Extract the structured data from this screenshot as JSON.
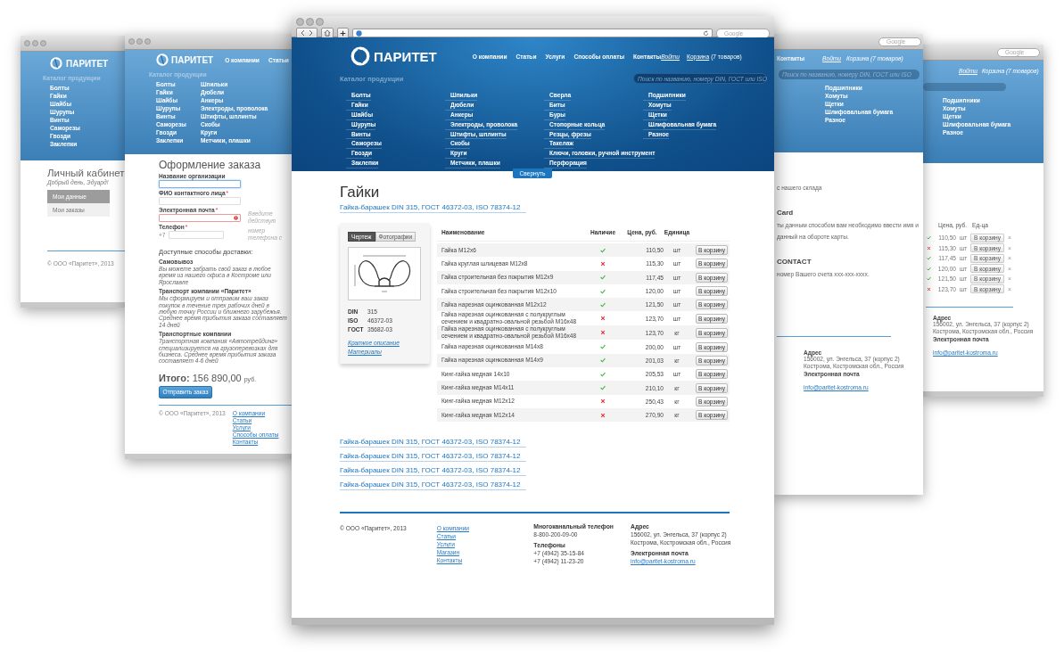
{
  "account_window": {
    "logo": "ПАРИТЕТ",
    "catalog_title": "Каталог продукции",
    "catalog_items": [
      "Болты",
      "Гайки",
      "Шайбы",
      "Шурупы",
      "Винты",
      "Саморезы",
      "Гвозди",
      "Заклепки"
    ],
    "title": "Личный кабинет",
    "greeting": "Добрый день, Эдуард!",
    "menu": [
      {
        "label": "Мои данные",
        "selected": true
      },
      {
        "label": "Мои заказы",
        "selected": false
      }
    ],
    "copyright": "© ООО «Паритет», 2013"
  },
  "order_window": {
    "logo": "ПАРИТЕТ",
    "nav": [
      "О компании",
      "Статьи"
    ],
    "catalog_title": "Каталог продукции",
    "catalog_columns": [
      [
        "Болты",
        "Гайки",
        "Шайбы",
        "Шурупы",
        "Винты",
        "Саморезы",
        "Гвозди",
        "Заклепки"
      ],
      [
        "Шпильки",
        "Дюбели",
        "Анкеры",
        "Электроды, проволока",
        "Штифты, шплинты",
        "Скобы",
        "Круги",
        "Метчики, плашки"
      ]
    ],
    "title": "Оформление заказа",
    "fields": [
      {
        "label": "Название организации",
        "focused": true,
        "error": false
      },
      {
        "label": "ФИО контактного лица",
        "required_mark": "*",
        "focused": false,
        "error": false
      },
      {
        "label": "Электронная почта",
        "required_mark": "*",
        "focused": false,
        "error": true,
        "hint": "Введите действую"
      },
      {
        "label": "Телефон",
        "required_mark": "*",
        "focused": false,
        "error": false,
        "prefix": "+7",
        "hint": "номер телефона с"
      }
    ],
    "delivery_title": "Доступные способы доставки:",
    "delivery": [
      {
        "name": "Самовывоз",
        "text": "Вы можете забрать свой заказ в любое время из нашего офиса в Костроме или Ярославле"
      },
      {
        "name": "Транспорт компании «Паритет»",
        "text": "Мы сформируем и отправим ваш заказ покупок в течение трех рабочих дней в любую точку России и ближнего зарубежья. Среднее время прибытия заказа составляет 14 дней"
      },
      {
        "name": "Транспортные компании",
        "text": "Транспортная компания «Автотрейдинг» специализируется на грузоперевозках для бизнеса. Среднее время прибытия заказа составляет 4-6 дней"
      }
    ],
    "total_label": "Итого:",
    "total": "156 890,00",
    "currency": "руб.",
    "submit": "Отправить заказ",
    "copyright": "© ООО «Паритет», 2013",
    "footer_links": [
      "О компании",
      "Статьи",
      "Услуги",
      "Способы оплаты",
      "Контакты"
    ]
  },
  "main_window": {
    "browser": {
      "search_placeholder": "Google"
    },
    "header": {
      "logo": "ПАРИТЕТ",
      "nav": [
        "О компании",
        "Статьи",
        "Услуги",
        "Способы оплаты",
        "Контакты"
      ],
      "login": "Войти",
      "cart": "Корзина",
      "cart_count": "(7 товаров)"
    },
    "catalog": {
      "title": "Каталог продукции",
      "search_placeholder": "Поиск по названию, номеру DIN, ГОСТ или ISO",
      "columns": [
        [
          "Болты",
          "Гайки",
          "Шайбы",
          "Шурупы",
          "Винты",
          "Саморезы",
          "Гвозди",
          "Заклепки"
        ],
        [
          "Шпильки",
          "Дюбели",
          "Анкеры",
          "Электроды, проволока",
          "Штифты, шплинты",
          "Скобы",
          "Круги",
          "Метчики, плашки"
        ],
        [
          "Сверла",
          "Биты",
          "Буры",
          "Стопорные кольца",
          "Резцы, фрезы",
          "Такелаж",
          "Ключи, головки, ручной инструмент",
          "Перфорация"
        ],
        [
          "Подшипники",
          "Хомуты",
          "Щетки",
          "Шлифовальная бумага",
          "Разное"
        ]
      ],
      "collapse": "Свернуть"
    },
    "page": {
      "title": "Гайки",
      "product_link": "Гайка-барашек DIN 315, ГОСТ 46372-03, ISO 78374-12",
      "card": {
        "tabs": [
          {
            "label": "Чертеж",
            "selected": true
          },
          {
            "label": "Фотографии",
            "selected": false
          }
        ],
        "specs": [
          {
            "label": "DIN",
            "value": "315"
          },
          {
            "label": "ISO",
            "value": "46372-03"
          },
          {
            "label": "ГОСТ",
            "value": "35682-03"
          }
        ],
        "links": [
          "Краткое описание",
          "Материалы"
        ]
      },
      "table": {
        "columns": [
          "Наименование",
          "Наличие",
          "Цена, руб.",
          "Единица"
        ],
        "rows": [
          {
            "name": "Гайка М12х6",
            "in_stock": true,
            "price": "110,50",
            "unit": "шт",
            "button": "В корзину"
          },
          {
            "name": "Гайка круглая шлицевая М12х8",
            "in_stock": false,
            "price": "115,30",
            "unit": "шт",
            "button": "В корзину"
          },
          {
            "name": "Гайка строительная без покрытия М12х9",
            "in_stock": true,
            "price": "117,45",
            "unit": "шт",
            "button": "В корзину"
          },
          {
            "name": "Гайка строительная без покрытия М12х10",
            "in_stock": true,
            "price": "120,00",
            "unit": "шт",
            "button": "В корзину"
          },
          {
            "name": "Гайка нарезная оцинкованная М12х12",
            "in_stock": true,
            "price": "121,50",
            "unit": "шт",
            "button": "В корзину"
          },
          {
            "name": "Гайка нарезная оцинкованная с полукруглым сечением и квадратно-овальной резьбой М16х48",
            "in_stock": false,
            "price": "123,70",
            "unit": "шт",
            "button": "В корзину"
          },
          {
            "name": "Гайка нарезная оцинкованная с полукруглым сечением и квадратно-овальной резьбой М16х48",
            "in_stock": false,
            "price": "123,70",
            "unit": "кг",
            "button": "В корзину"
          },
          {
            "name": "Гайка нарезная оцинкованная М14х8",
            "in_stock": true,
            "price": "200,00",
            "unit": "шт",
            "button": "В корзину"
          },
          {
            "name": "Гайка нарезная оцинкованная М14х9",
            "in_stock": true,
            "price": "201,03",
            "unit": "кг",
            "button": "В корзину"
          },
          {
            "name": "Кинг-гайка медная 14х10",
            "in_stock": true,
            "price": "205,53",
            "unit": "шт",
            "button": "В корзину"
          },
          {
            "name": "Кинг-гайка медная М14х11",
            "in_stock": true,
            "price": "210,10",
            "unit": "кг",
            "button": "В корзину"
          },
          {
            "name": "Кинг-гайка медная М12х12",
            "in_stock": false,
            "price": "250,43",
            "unit": "кг",
            "button": "В корзину"
          },
          {
            "name": "Кинг-гайка медная М12х14",
            "in_stock": false,
            "price": "270,90",
            "unit": "кг",
            "button": "В корзину"
          }
        ]
      },
      "related_links": [
        "Гайка-барашек DIN 315, ГОСТ 46372-03, ISO 78374-12",
        "Гайка-барашек DIN 315, ГОСТ 46372-03, ISO 78374-12",
        "Гайка-барашек DIN 315, ГОСТ 46372-03, ISO 78374-12",
        "Гайка-барашек DIN 315, ГОСТ 46372-03, ISO 78374-12"
      ]
    },
    "footer": {
      "copyright": "© ООО «Паритет», 2013",
      "links": [
        "О компании",
        "Статьи",
        "Услуги",
        "Магазин",
        "Контакты"
      ],
      "blocks": [
        {
          "title": "Многоканальный телефон",
          "lines": [
            "8-800-200-09-00"
          ]
        },
        {
          "title": "Телефоны",
          "lines": [
            "+7 (4942) 35-15-84",
            "+7 (4942) 11-23-20"
          ]
        }
      ],
      "address_title": "Адрес",
      "address_lines": [
        "156002, ул. Энгельса, 37 (корпус 2)",
        "Кострома, Костромская обл., Россия"
      ],
      "email_title": "Электронная почта",
      "email": "info@paritet-kostroma.ru"
    }
  },
  "payment_window": {
    "browser_search_placeholder": "Google",
    "nav": [
      "Контакты"
    ],
    "login": "Войти",
    "cart": "Корзина (7 товаров)",
    "search_placeholder": "Поиск по названию, номеру DIN, ГОСТ или ISO",
    "catalog_items": [
      "Подшипники",
      "Хомуты",
      "Щетки",
      "Шлифовальная бумага",
      "Разное"
    ],
    "fragments": [
      {
        "kind": "text",
        "text": "с нашего склада"
      },
      {
        "kind": "heading",
        "text": "Card"
      },
      {
        "kind": "text",
        "text": "ты данным способом вам необходимо ввести имя и"
      },
      {
        "kind": "text",
        "text": "данный на обороте карты."
      },
      {
        "kind": "heading",
        "text": "CONTACT"
      },
      {
        "kind": "text",
        "text": "номер Вашего счета ххх-ххх-хххх."
      }
    ],
    "address_title": "Адрес",
    "address_lines": [
      "156002, ул. Энгельса, 37 (корпус 2)",
      "Кострома, Костромская обл., Россия"
    ],
    "email_title": "Электронная почта",
    "email": "info@paritet-kostroma.ru"
  },
  "cart_window": {
    "search_placeholder": "Google",
    "login": "Войти",
    "cart": "Корзина (7 товаров)",
    "catalog_items": [
      "Подшипники",
      "Хомуты",
      "Щетки",
      "Шлифовальная бумага",
      "Разное"
    ],
    "columns": [
      "Цена, руб.",
      "Ед-ца"
    ],
    "rows": [
      {
        "in_stock": true,
        "price": "110,50",
        "unit": "шт",
        "button": "В корзину",
        "remove": "×"
      },
      {
        "in_stock": false,
        "price": "115,30",
        "unit": "шт",
        "button": "В корзину",
        "remove": "×"
      },
      {
        "in_stock": true,
        "price": "117,45",
        "unit": "шт",
        "button": "В корзину",
        "remove": "×"
      },
      {
        "in_stock": true,
        "price": "120,00",
        "unit": "шт",
        "button": "В корзину",
        "remove": "×"
      },
      {
        "in_stock": true,
        "price": "121,50",
        "unit": "шт",
        "button": "В корзину",
        "remove": "×"
      },
      {
        "in_stock": false,
        "price": "123,70",
        "unit": "шт",
        "button": "В корзину",
        "remove": "×"
      }
    ],
    "address_title": "Адрес",
    "address_lines": [
      "156002, ул. Энгельса, 37 (корпус 2)",
      "Кострома, Костромская обл., Россия"
    ],
    "email_title": "Электронная почта",
    "email": "info@paritet-kostroma.ru"
  }
}
